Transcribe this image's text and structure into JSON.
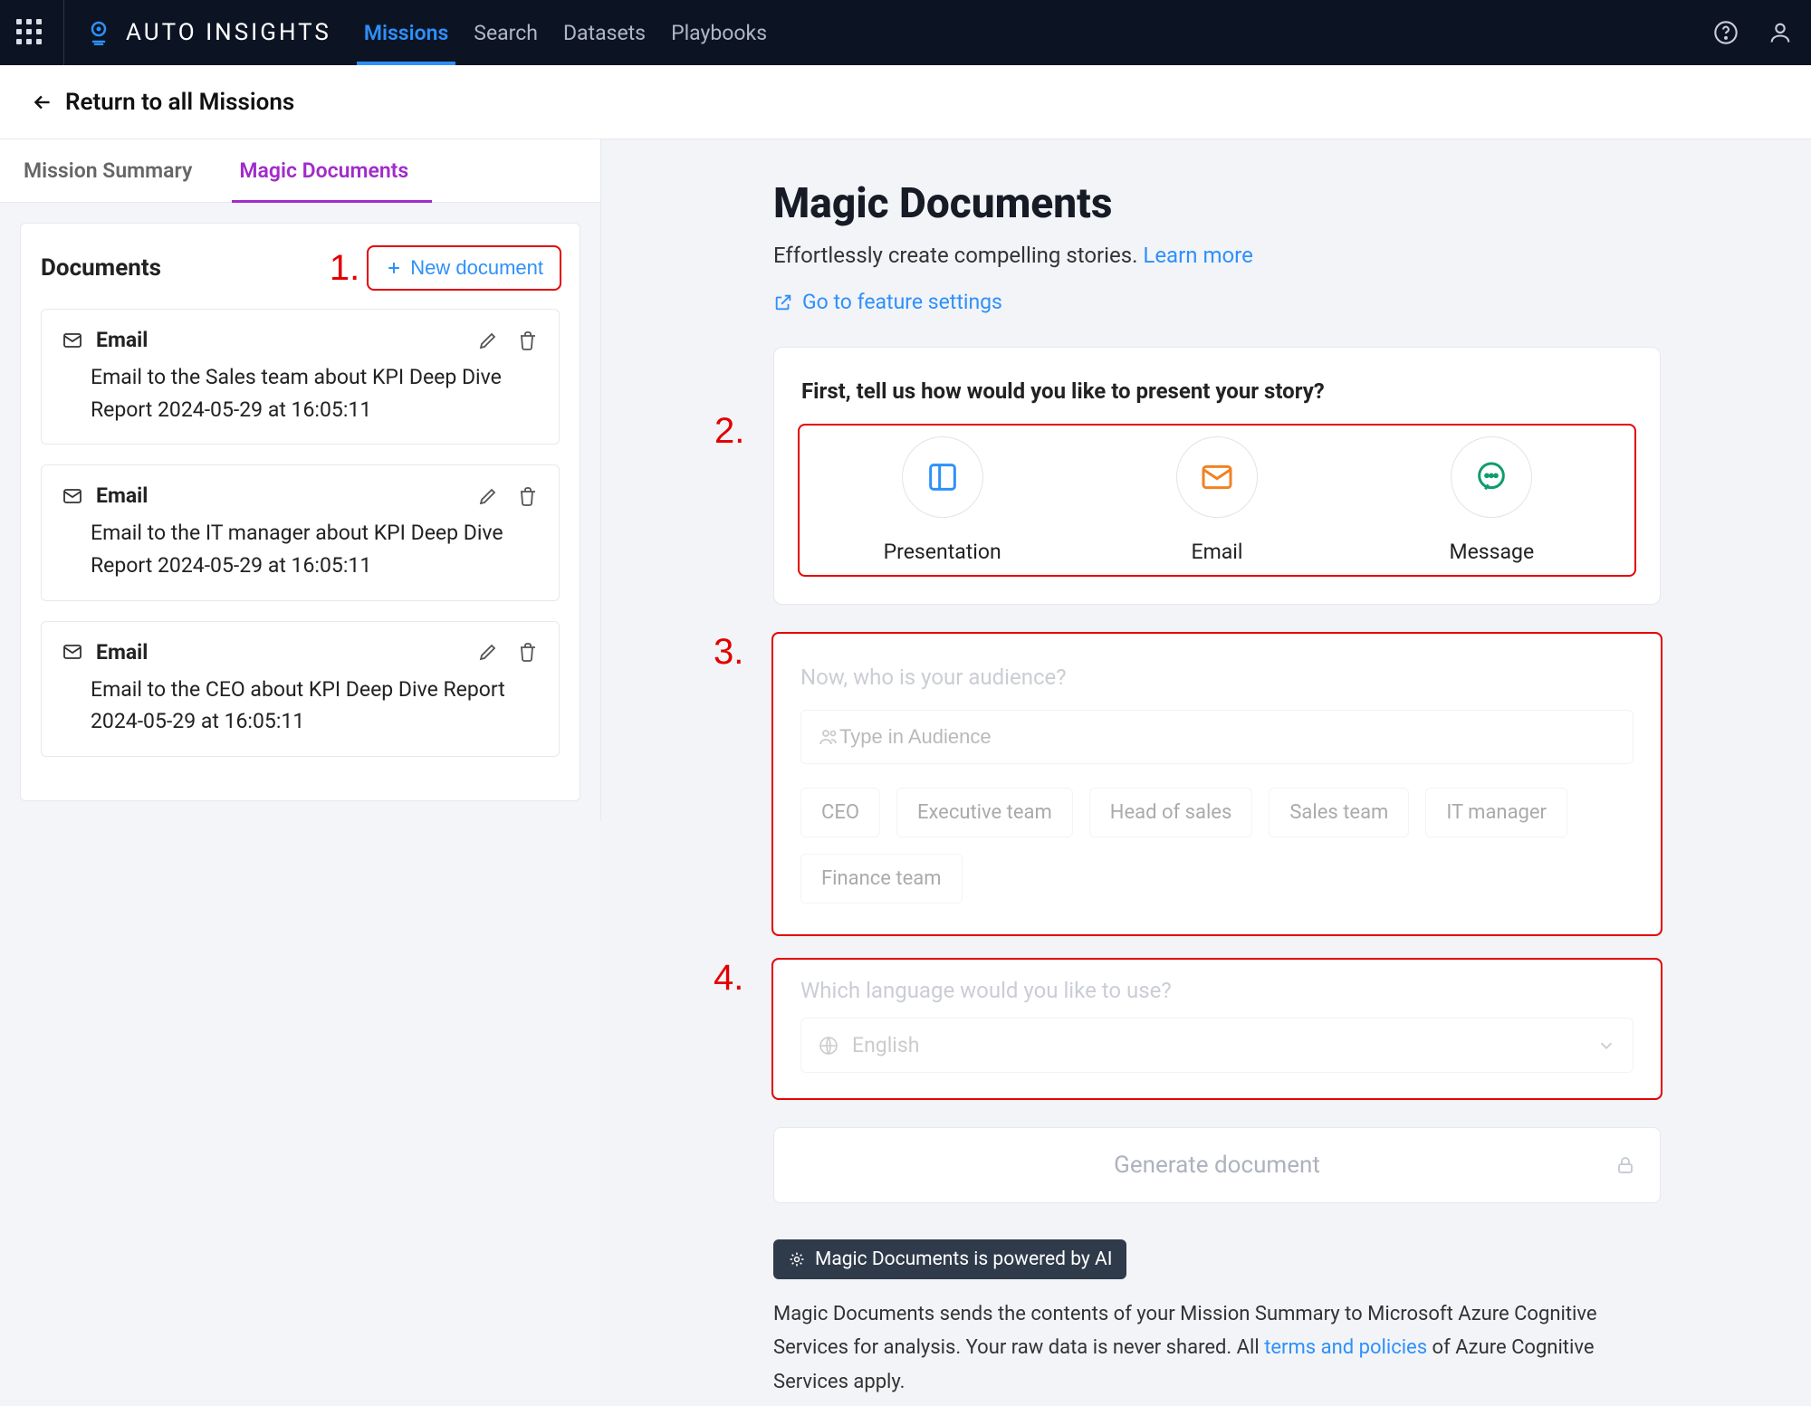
{
  "topnav": {
    "brand": "AUTO INSIGHTS",
    "links": [
      "Missions",
      "Search",
      "Datasets",
      "Playbooks"
    ],
    "active_index": 0
  },
  "breadcrumb": {
    "back_label": "Return to all Missions"
  },
  "sidebar": {
    "tabs": [
      "Mission Summary",
      "Magic Documents"
    ],
    "active_tab": 1,
    "panel_title": "Documents",
    "new_doc_label": "New document",
    "docs": [
      {
        "type": "Email",
        "desc": "Email to the Sales team about KPI Deep Dive Report 2024-05-29 at 16:05:11"
      },
      {
        "type": "Email",
        "desc": "Email to the IT manager about KPI Deep Dive Report 2024-05-29 at 16:05:11"
      },
      {
        "type": "Email",
        "desc": "Email to the CEO about KPI Deep Dive Report 2024-05-29 at 16:05:11"
      }
    ]
  },
  "annotations": {
    "n1": "1.",
    "n2": "2.",
    "n3": "3.",
    "n4": "4."
  },
  "page": {
    "title": "Magic Documents",
    "subtitle_a": "Effortlessly create compelling stories. ",
    "subtitle_link": "Learn more",
    "feat_settings": "Go to feature settings"
  },
  "step1": {
    "heading": "First, tell us how would you like to present your story?",
    "options": [
      "Presentation",
      "Email",
      "Message"
    ]
  },
  "step2": {
    "heading": "Now, who is your audience?",
    "placeholder": "Type in Audience",
    "chips": [
      "CEO",
      "Executive team",
      "Head of sales",
      "Sales team",
      "IT manager",
      "Finance team"
    ]
  },
  "step3": {
    "heading": "Which language would you like to use?",
    "value": "English"
  },
  "generate_label": "Generate document",
  "footer": {
    "powered": "Magic Documents is powered by AI",
    "text_a": "Magic Documents sends the contents of your Mission Summary to Microsoft Azure Cognitive Services for analysis. Your raw data is never shared. All ",
    "text_link": "terms and policies",
    "text_b": " of Azure Cognitive Services apply."
  }
}
